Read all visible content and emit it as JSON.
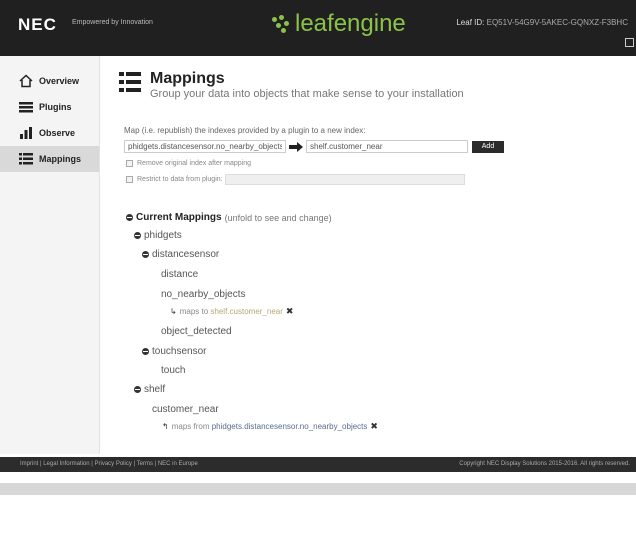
{
  "header": {
    "brand": "NEC",
    "tagline": "Empowered by Innovation",
    "app_name": "leafengine",
    "leaf_id_label": "Leaf ID:",
    "leaf_id_value": "EQ51V-54G9V-5AKEC-GQNXZ-F3BHC",
    "accent_color": "#8bc34a"
  },
  "sidebar": {
    "items": [
      {
        "label": "Overview",
        "icon": "home-icon"
      },
      {
        "label": "Plugins",
        "icon": "stack-icon"
      },
      {
        "label": "Observe",
        "icon": "bar-chart-icon"
      },
      {
        "label": "Mappings",
        "icon": "list-icon",
        "active": true
      }
    ]
  },
  "page": {
    "title": "Mappings",
    "subtitle": "Group your data into objects that make sense to your installation",
    "icon": "list-icon"
  },
  "form": {
    "label": "Map (i.e. republish) the indexes provided by a plugin to a new index:",
    "source_value": "phidgets.distancesensor.no_nearby_objects",
    "target_value": "shelf.customer_near",
    "add_label": "Add",
    "remove_original_label": "Remove original index after mapping",
    "restrict_label": "Restrict to data from plugin:"
  },
  "tree": {
    "header_title": "Current Mappings",
    "header_hint": "(unfold to see and change)",
    "nodes": {
      "phidgets": "phidgets",
      "distancesensor": "distancesensor",
      "distance": "distance",
      "no_nearby_objects": "no_nearby_objects",
      "maps_to_prefix": "maps to",
      "maps_to_target": "shelf.customer_near",
      "object_detected": "object_detected",
      "touchsensor": "touchsensor",
      "touch": "touch",
      "shelf": "shelf",
      "customer_near": "customer_near",
      "maps_from_prefix": "maps from",
      "maps_from_source": "phidgets.distancesensor.no_nearby_objects"
    }
  },
  "footer": {
    "links": "Imprint  |  Legal Information  |  Privacy Policy  |  Terms  |  NEC in Europe",
    "copyright": "Copyright NEC Display Solutions 2015-2016. All rights reserved."
  }
}
